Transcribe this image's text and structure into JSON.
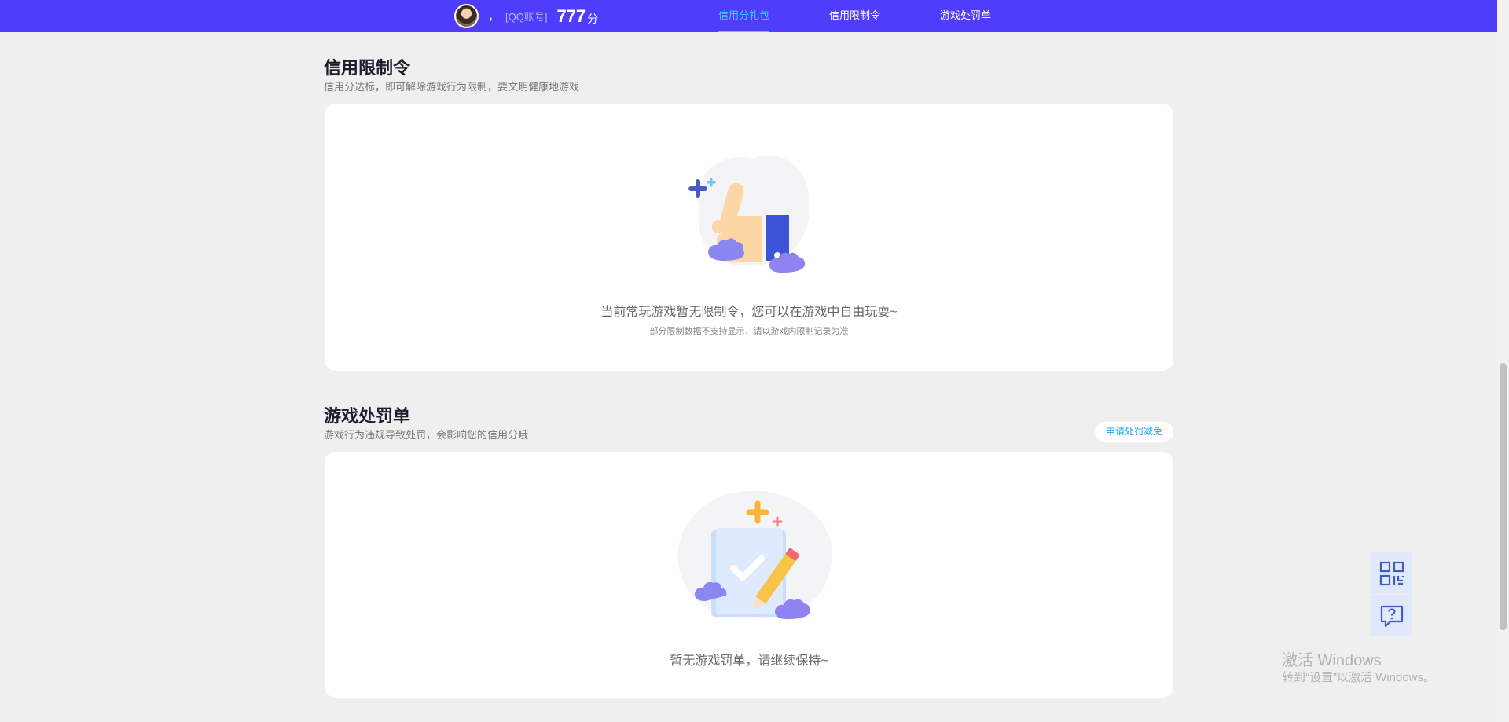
{
  "header": {
    "comma": "，",
    "account_label": "[QQ账号]",
    "score": "777",
    "score_unit": "分",
    "nav": [
      {
        "label": "信用分礼包",
        "active": true
      },
      {
        "label": "信用限制令",
        "active": false
      },
      {
        "label": "游戏处罚单",
        "active": false
      }
    ]
  },
  "restriction": {
    "title": "信用限制令",
    "subtitle": "信用分达标，即可解除游戏行为限制，要文明健康地游戏",
    "empty_title": "当前常玩游戏暂无限制令，您可以在游戏中自由玩耍~",
    "empty_note": "部分限制数据不支持显示，请以游戏内限制记录为准",
    "illustration": "thumbs-up-icon"
  },
  "penalty": {
    "title": "游戏处罚单",
    "subtitle": "游戏行为违规导致处罚，会影响您的信用分哦",
    "apply_button": "申请处罚减免",
    "empty_title": "暂无游戏罚单，请继续保持~",
    "illustration": "checklist-pencil-icon"
  },
  "side": {
    "qr_icon": "qrcode-icon",
    "help_icon": "help-chat-icon"
  },
  "watermark": {
    "line1": "激活 Windows",
    "line2": "转到“设置”以激活 Windows。"
  },
  "colors": {
    "nav_bg": "#4f3dfb",
    "nav_active": "#35d3ff",
    "page_bg": "#efefef",
    "link": "#1fa6ee"
  }
}
